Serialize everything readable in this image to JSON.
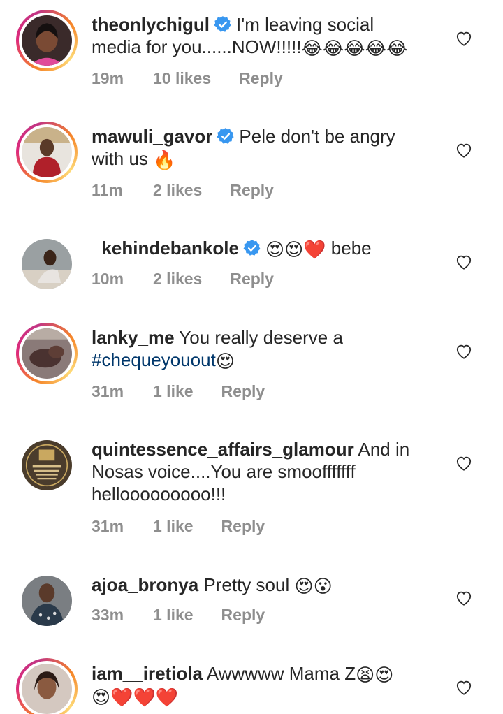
{
  "comments": [
    {
      "username": "theonlychigul",
      "verified": true,
      "line1": "I'm leaving social",
      "line2": "media for you......NOW!!!!!",
      "emojis_line2": "😂😂😂😂😂",
      "time": "19m",
      "likes": "10 likes",
      "reply": "Reply"
    },
    {
      "username": "mawuli_gavor",
      "verified": true,
      "line1": "Pele don't be angry",
      "line2": "with us",
      "emojis_line2": "🔥",
      "time": "11m",
      "likes": "2 likes",
      "reply": "Reply"
    },
    {
      "username": "_kehindebankole",
      "verified": true,
      "emojis_line1": "😍😍❤️",
      "line1": "bebe",
      "time": "10m",
      "likes": "2 likes",
      "reply": "Reply"
    },
    {
      "username": "lanky_me",
      "verified": false,
      "line1": "You really deserve a",
      "hashtag": "#chequeyouout",
      "emojis_line2": "😍",
      "time": "31m",
      "likes": "1 like",
      "reply": "Reply"
    },
    {
      "username": "quintessence_affairs_glamour",
      "verified": false,
      "line1": "And in",
      "line2": "Nosas voice....You are smoofffffff",
      "line3": "hellooooooooo!!!",
      "time": "31m",
      "likes": "1 like",
      "reply": "Reply"
    },
    {
      "username": "ajoa_bronya",
      "verified": false,
      "line1": "Pretty soul",
      "emojis_line1": "😍😮",
      "time": "33m",
      "likes": "1 like",
      "reply": "Reply"
    },
    {
      "username": "iam__iretiola",
      "verified": false,
      "line1": "Awwwww Mama Z",
      "emojis_line1": "😫😍",
      "emojis_line2": "😍❤️❤️❤️"
    }
  ],
  "colors": {
    "text": "#262626",
    "meta": "#8e8e8e",
    "verified": "#3897f0",
    "hashtag": "#00376b"
  }
}
